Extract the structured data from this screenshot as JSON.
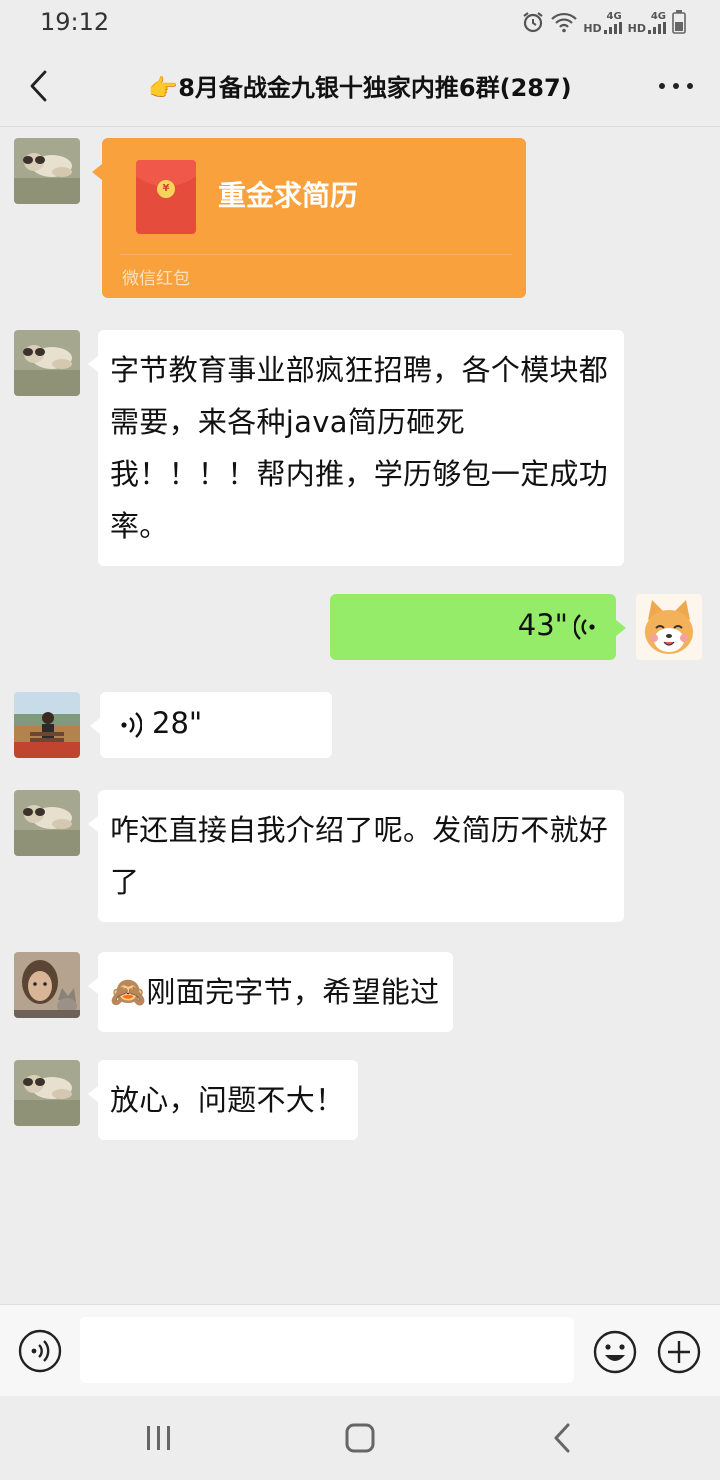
{
  "status_bar": {
    "time": "19:12",
    "network_label_1": "HD",
    "network_type_1": "4G",
    "network_label_2": "HD",
    "network_type_2": "4G"
  },
  "header": {
    "title": "👉8月备战金九银十独家内推6群(287)",
    "back_icon": "chevron-left",
    "more_icon": "ellipsis"
  },
  "messages": [
    {
      "type": "red_packet",
      "side": "left",
      "title": "重金求简历",
      "footer": "微信红包"
    },
    {
      "type": "text",
      "side": "left",
      "text": "字节教育事业部疯狂招聘，各个模块都需要，来各种java简历砸死我！！！！帮内推，学历够包一定成功率。"
    },
    {
      "type": "voice",
      "side": "right",
      "duration": "43\""
    },
    {
      "type": "voice",
      "side": "left",
      "duration": "28\""
    },
    {
      "type": "text",
      "side": "left",
      "text": "咋还直接自我介绍了呢。发简历不就好了"
    },
    {
      "type": "text",
      "side": "left",
      "text": "🙈刚面完字节，希望能过"
    },
    {
      "type": "text",
      "side": "left",
      "text": "放心，问题不大！"
    }
  ],
  "input_bar": {
    "placeholder": "",
    "voice_icon": "voice",
    "emoji_icon": "smiley",
    "plus_icon": "plus"
  },
  "colors": {
    "background": "#ededed",
    "self_bubble": "#95ec69",
    "red_packet": "#f9a13c"
  }
}
